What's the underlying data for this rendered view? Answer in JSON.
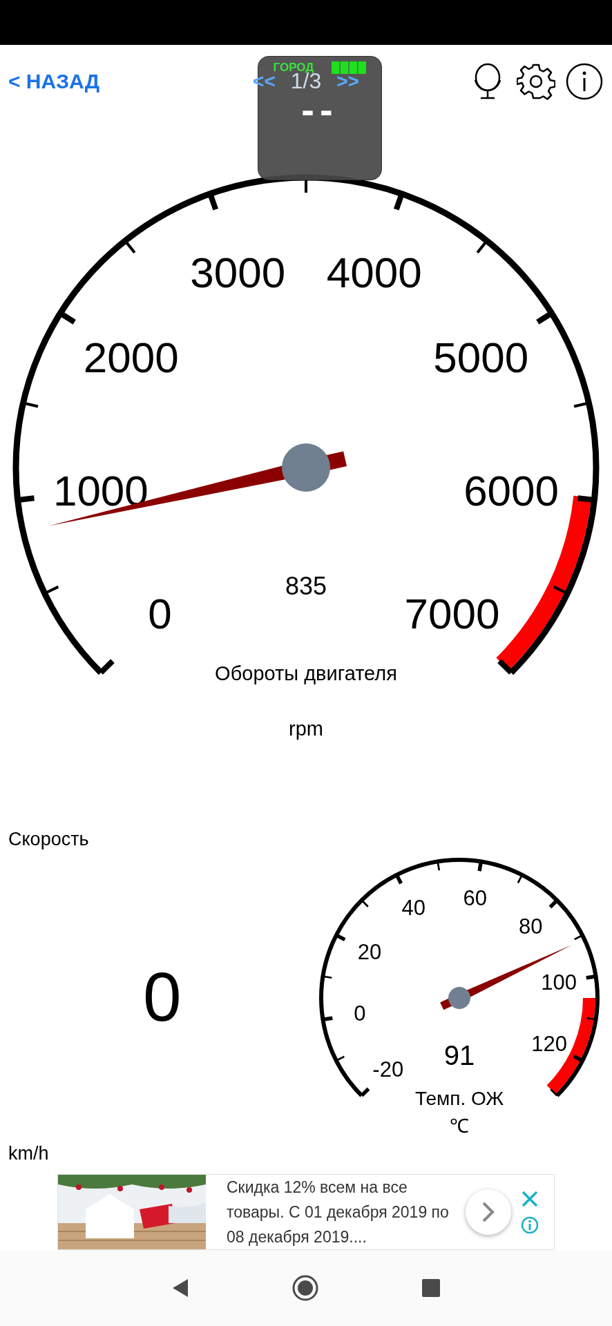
{
  "header": {
    "back": "< НАЗАД",
    "prev": "<<",
    "page": "1/3",
    "next": ">>"
  },
  "overlay": {
    "mode": "ГОРОД",
    "value": "--"
  },
  "rpm_gauge": {
    "labels": [
      "0",
      "1000",
      "2000",
      "3000",
      "4000",
      "5000",
      "6000",
      "7000"
    ],
    "reading": "835",
    "title": "Обороты двигателя",
    "unit": "rpm"
  },
  "speed": {
    "title": "Скорость",
    "value": "0",
    "unit": "km/h"
  },
  "temp_gauge": {
    "labels": [
      "-20",
      "0",
      "20",
      "40",
      "60",
      "80",
      "100",
      "120"
    ],
    "reading": "91",
    "title": "Темп. ОЖ",
    "unit": "℃"
  },
  "ad": {
    "kind": "picture",
    "text": "Скидка 12% всем на все товары. С 01 декабря 2019 по 08 декабря 2019...."
  }
}
